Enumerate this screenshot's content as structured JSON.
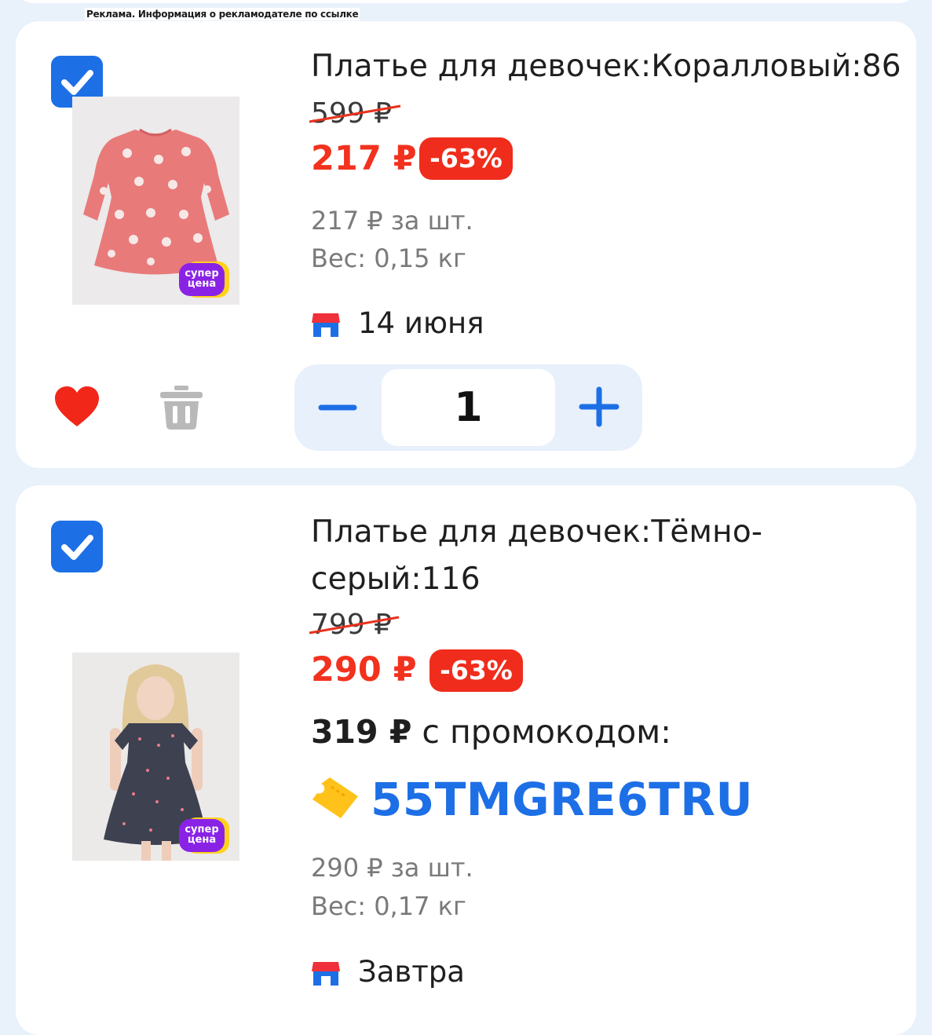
{
  "ad_notice": "Реклама. Информация о рекламодателе по ссылке",
  "items": [
    {
      "checked": true,
      "title": "Платье для девочек:Коралловый:86",
      "old_price": "599 ₽",
      "price": "217 ₽",
      "discount": "-63%",
      "unit_price": "217 ₽ за шт.",
      "weight": "Вес: 0,15 кг",
      "delivery": "14 июня",
      "badge": "супер цена",
      "badge_line1": "супер",
      "badge_line2": "цена",
      "quantity": "1",
      "favorite": true,
      "image_icon": "coral-dress-image"
    },
    {
      "checked": true,
      "title_line1": "Платье для девочек:Тёмно-",
      "title_line2": "серый:116",
      "old_price": "799 ₽",
      "price": "290 ₽",
      "discount": "-63%",
      "promo_price": "319 ₽",
      "promo_text": " с промокодом:",
      "promo_code": "55TMGRE6TRU",
      "unit_price": "290 ₽ за шт.",
      "weight": "Вес: 0,17 кг",
      "delivery": "Завтра",
      "badge_line1": "супер",
      "badge_line2": "цена",
      "image_icon": "grey-dress-girl-image"
    }
  ],
  "colors": {
    "accent_blue": "#1d6fe6",
    "price_red": "#f2321e",
    "background": "#e9f1fb"
  },
  "icons": {
    "checkbox": "check-icon",
    "favorite": "heart-icon",
    "delete": "trash-icon",
    "minus": "minus-icon",
    "plus": "plus-icon",
    "shop": "shop-icon",
    "ticket": "ticket-icon"
  }
}
